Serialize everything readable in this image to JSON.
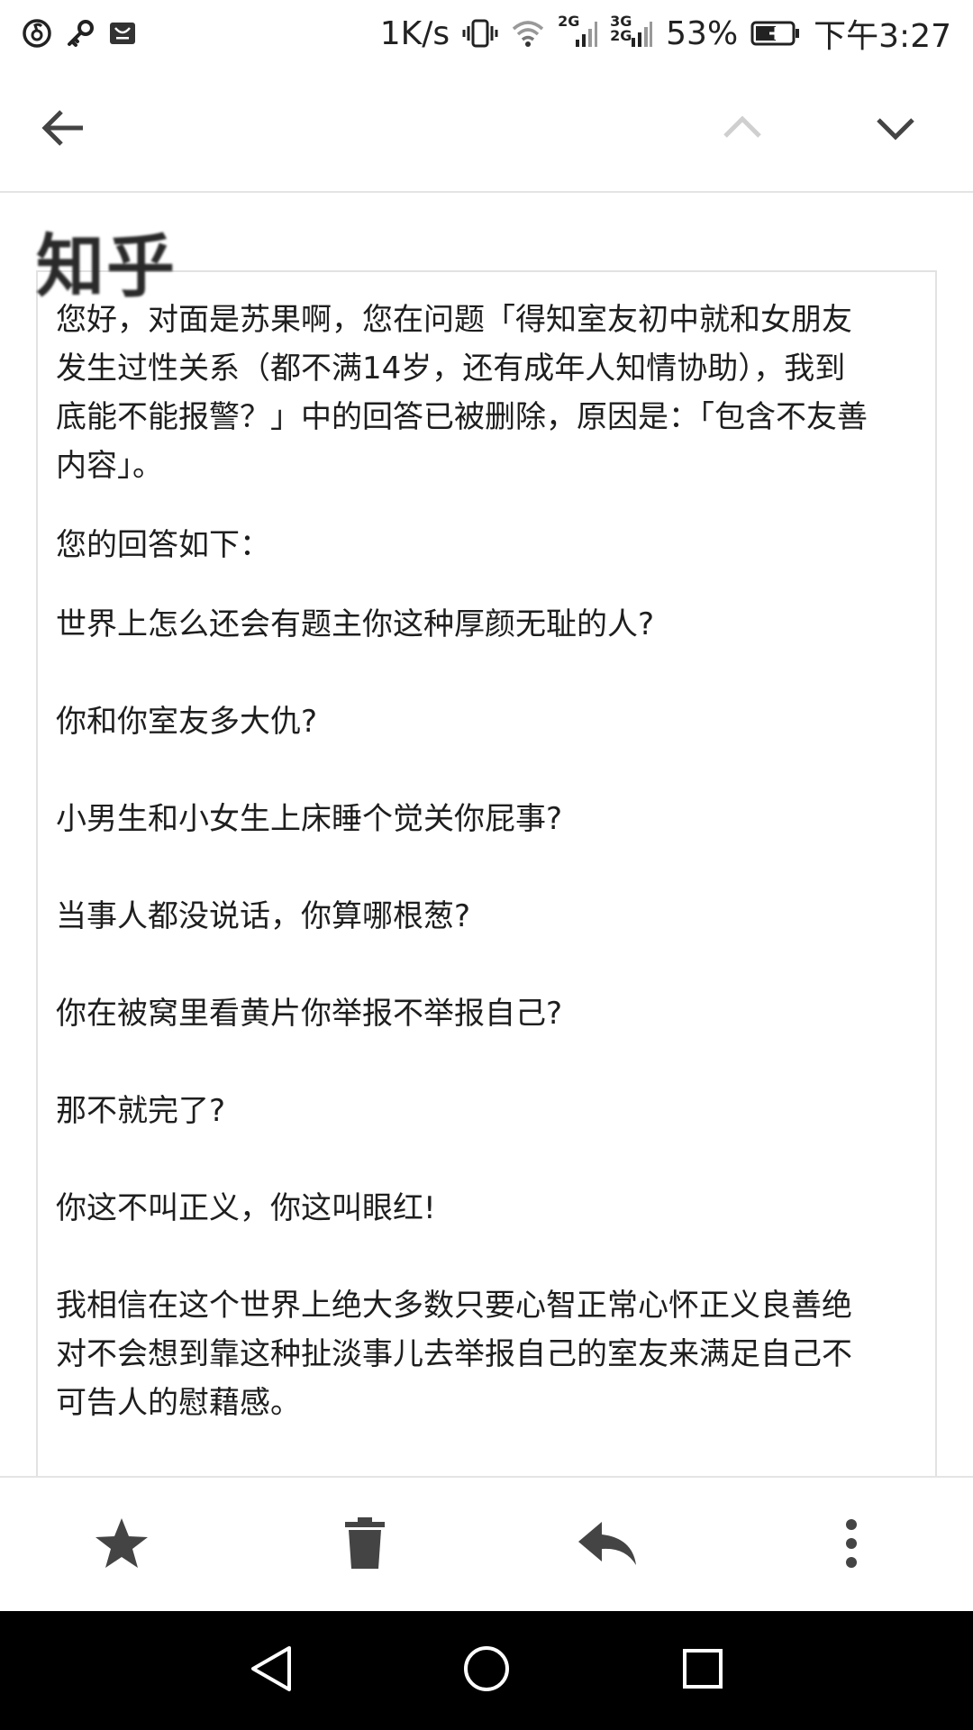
{
  "status_bar": {
    "left_icons": [
      "netease-music-icon",
      "key-icon",
      "huawei-icon"
    ],
    "net_speed": "1K/s",
    "sig1_label": "2G",
    "sig2_label_top": "3G",
    "sig2_label_bottom": "2G",
    "battery": "53%",
    "time": "下午3:27"
  },
  "action_bar": {
    "back_icon": "back-arrow-icon",
    "prev_icon": "chevron-up-icon",
    "next_icon": "chevron-down-icon"
  },
  "email": {
    "logo": "知乎",
    "paragraphs": [
      "您好，对面是苏果啊，您在问题「得知室友初中就和女朋友发生过性关系（都不满14岁，还有成年人知情协助），我到底能不能报警？」中的回答已被删除，原因是：「包含不友善内容」。",
      "您的回答如下：",
      "世界上怎么还会有题主你这种厚颜无耻的人?",
      "你和你室友多大仇?",
      "小男生和小女生上床睡个觉关你屁事?",
      "当事人都没说话，你算哪根葱?",
      "你在被窝里看黄片你举报不举报自己?",
      "那不就完了?",
      "你这不叫正义，你这叫眼红!",
      "我相信在这个世界上绝大多数只要心智正常心怀正义良善绝对不会想到靠这种扯淡事儿去举报自己的室友来满足自己不可告人的慰藉感。"
    ]
  },
  "bottom_toolbar": {
    "icons": [
      "star-icon",
      "delete-icon",
      "reply-icon",
      "more-vert-icon"
    ]
  },
  "nav_bar": {
    "icons": [
      "nav-back-icon",
      "nav-home-icon",
      "nav-recents-icon"
    ]
  },
  "colors": {
    "background": "#ffffff",
    "text": "#1e1e1e",
    "nav_bar": "#000000",
    "divider": "#e4e4e4"
  }
}
